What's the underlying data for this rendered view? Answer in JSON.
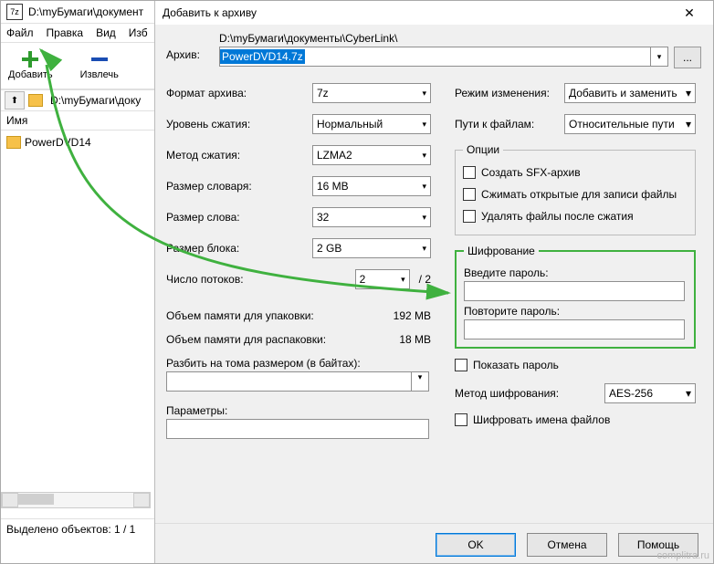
{
  "main": {
    "title": "D:\\myБумаги\\документ",
    "menu": [
      "Файл",
      "Правка",
      "Вид",
      "Изб"
    ],
    "toolbar": {
      "add": "Добавить",
      "extract": "Извлечь"
    },
    "path": "D:\\myБумаги\\доку",
    "col_name": "Имя",
    "file": "PowerDVD14",
    "status": "Выделено объектов: 1 / 1"
  },
  "dialog": {
    "title": "Добавить к архиву",
    "archive_label": "Архив:",
    "archive_dir": "D:\\myБумаги\\документы\\CyberLink\\",
    "archive_file": "PowerDVD14.7z",
    "browse": "...",
    "left": {
      "format_l": "Формат архива:",
      "format_v": "7z",
      "level_l": "Уровень сжатия:",
      "level_v": "Нормальный",
      "method_l": "Метод сжатия:",
      "method_v": "LZMA2",
      "dict_l": "Размер словаря:",
      "dict_v": "16 MB",
      "word_l": "Размер слова:",
      "word_v": "32",
      "block_l": "Размер блока:",
      "block_v": "2 GB",
      "threads_l": "Число потоков:",
      "threads_v": "2",
      "threads_max": "/ 2",
      "mem_pack_l": "Объем памяти для упаковки:",
      "mem_pack_v": "192 MB",
      "mem_unpack_l": "Объем памяти для распаковки:",
      "mem_unpack_v": "18 MB",
      "split_l": "Разбить на тома размером (в байтах):",
      "params_l": "Параметры:"
    },
    "right": {
      "mode_l": "Режим изменения:",
      "mode_v": "Добавить и заменить",
      "paths_l": "Пути к файлам:",
      "paths_v": "Относительные пути",
      "opts_legend": "Опции",
      "opt_sfx": "Создать SFX-архив",
      "opt_open": "Сжимать открытые для записи файлы",
      "opt_del": "Удалять файлы после сжатия",
      "enc_legend": "Шифрование",
      "pass1": "Введите пароль:",
      "pass2": "Повторите пароль:",
      "show": "Показать пароль",
      "enc_method_l": "Метод шифрования:",
      "enc_method_v": "AES-256",
      "enc_names": "Шифровать имена файлов"
    },
    "btn_ok": "OK",
    "btn_cancel": "Отмена",
    "btn_help": "Помощь"
  },
  "watermark": "complitra.ru"
}
